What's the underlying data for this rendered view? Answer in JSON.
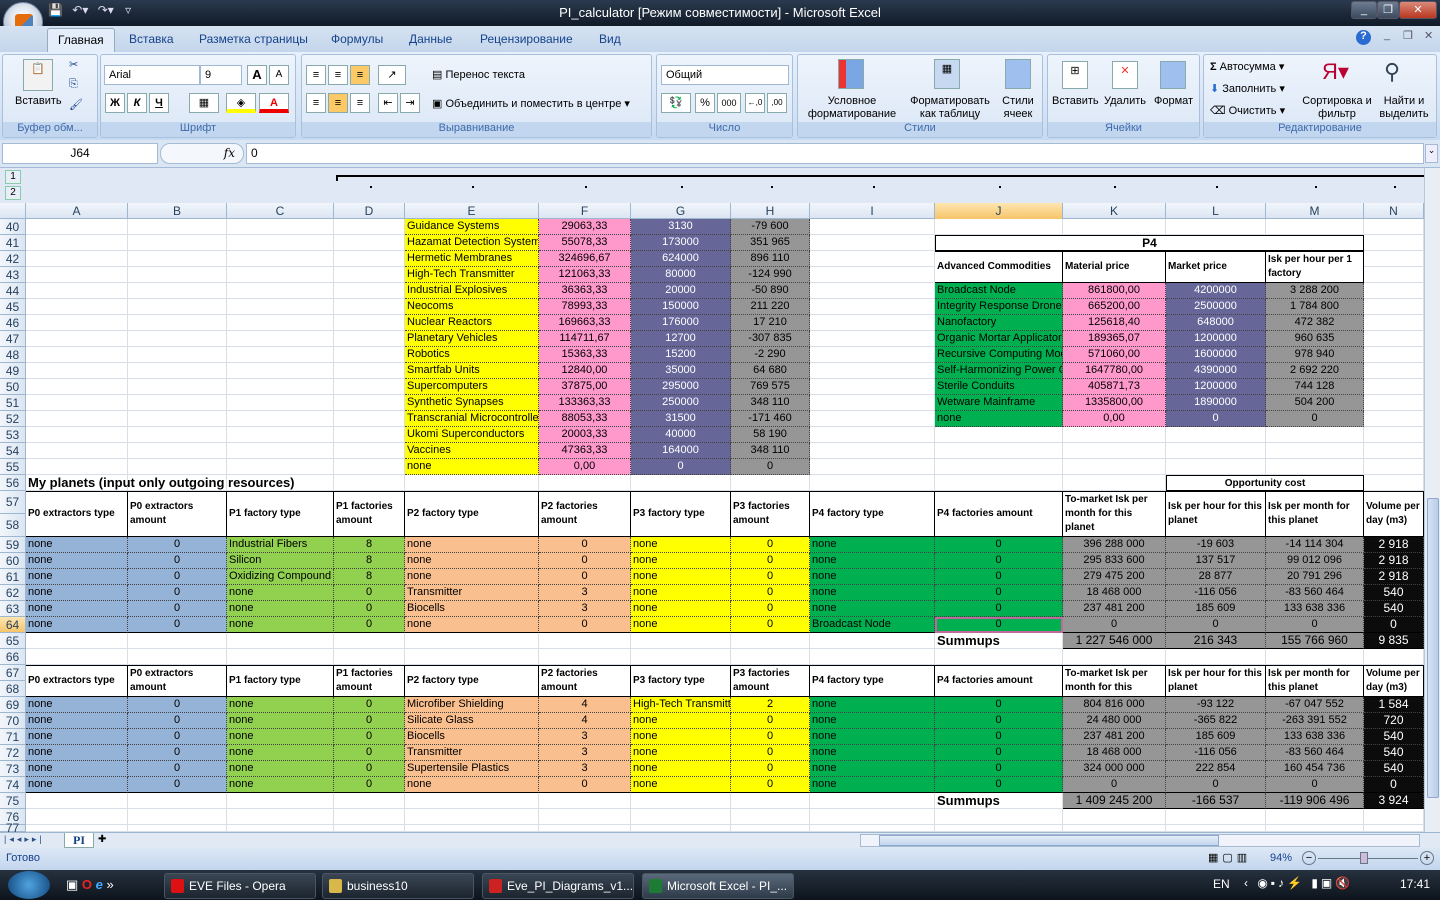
{
  "window": {
    "title": "PI_calculator  [Режим совместимости] - Microsoft Excel"
  },
  "ribbon": {
    "tabs": [
      "Главная",
      "Вставка",
      "Разметка страницы",
      "Формулы",
      "Данные",
      "Рецензирование",
      "Вид"
    ],
    "clipboard": {
      "paste": "Вставить",
      "label": "Буфер обм..."
    },
    "font": {
      "name": "Arial",
      "size": "9",
      "bold": "Ж",
      "italic": "К",
      "underline": "Ч",
      "grow": "A",
      "shrink": "A",
      "label": "Шрифт"
    },
    "alignment": {
      "wrap": "Перенос текста",
      "merge": "Объединить и поместить в центре",
      "label": "Выравнивание"
    },
    "number": {
      "format": "Общий",
      "percent": "%",
      "thousands": "000",
      "label": "Число"
    },
    "styles": {
      "conditional": "Условное форматирование",
      "as_table": "Форматировать как таблицу",
      "cell_styles": "Стили ячеек",
      "label": "Стили"
    },
    "cells": {
      "insert": "Вставить",
      "delete": "Удалить",
      "format": "Формат",
      "label": "Ячейки"
    },
    "editing": {
      "autosum": "Автосумма",
      "fill": "Заполнить",
      "clear": "Очистить",
      "sort": "Сортировка и фильтр",
      "find": "Найти и выделить",
      "label": "Редактирование"
    }
  },
  "formula_bar": {
    "name_box": "J64",
    "fx": "fx",
    "value": "0"
  },
  "outline_levels": [
    "1",
    "2"
  ],
  "columns": [
    "A",
    "B",
    "C",
    "D",
    "E",
    "F",
    "G",
    "H",
    "I",
    "J",
    "K",
    "L",
    "M",
    "N"
  ],
  "row_numbers": [
    "40",
    "41",
    "42",
    "43",
    "44",
    "45",
    "46",
    "47",
    "48",
    "49",
    "50",
    "51",
    "52",
    "53",
    "54",
    "55",
    "56",
    "57",
    "58",
    "59",
    "60",
    "61",
    "62",
    "63",
    "64",
    "65",
    "66",
    "67",
    "68",
    "69",
    "70",
    "71",
    "72",
    "73",
    "74",
    "75",
    "76",
    "77"
  ],
  "selected": {
    "column": "J",
    "row": "64"
  },
  "top_table": {
    "rows": [
      [
        "Guidance Systems",
        "29063,33",
        "3130",
        "-79 600"
      ],
      [
        "Hazamat Detection Systems",
        "55078,33",
        "173000",
        "351 965"
      ],
      [
        "Hermetic Membranes",
        "324696,67",
        "624000",
        "896 110"
      ],
      [
        "High-Tech Transmitter",
        "121063,33",
        "80000",
        "-124 990"
      ],
      [
        "Industrial Explosives",
        "36363,33",
        "20000",
        "-50 890"
      ],
      [
        "Neocoms",
        "78993,33",
        "150000",
        "211 220"
      ],
      [
        "Nuclear Reactors",
        "169663,33",
        "176000",
        "17 210"
      ],
      [
        "Planetary Vehicles",
        "114711,67",
        "12700",
        "-307 835"
      ],
      [
        "Robotics",
        "15363,33",
        "15200",
        "-2 290"
      ],
      [
        "Smartfab Units",
        "12840,00",
        "35000",
        "64 680"
      ],
      [
        "Supercomputers",
        "37875,00",
        "295000",
        "769 575"
      ],
      [
        "Synthetic Synapses",
        "133363,33",
        "250000",
        "348 110"
      ],
      [
        "Transcranial Microcontrollers",
        "88053,33",
        "31500",
        "-171 460"
      ],
      [
        "Ukomi Superconductors",
        "20003,33",
        "40000",
        "58 190"
      ],
      [
        "Vaccines",
        "47363,33",
        "164000",
        "348 110"
      ],
      [
        "none",
        "0,00",
        "0",
        "0"
      ]
    ]
  },
  "p4_table": {
    "title": "P4",
    "headers": [
      "Advanced Commodities",
      "Material price",
      "Market price",
      "Isk per hour per 1 factory"
    ],
    "rows": [
      [
        "Broadcast Node",
        "861800,00",
        "4200000",
        "3 288 200"
      ],
      [
        "Integrity Response Drones",
        "665200,00",
        "2500000",
        "1 784 800"
      ],
      [
        "Nanofactory",
        "125618,40",
        "648000",
        "472 382"
      ],
      [
        "Organic Mortar Applicators",
        "189365,07",
        "1200000",
        "960 635"
      ],
      [
        "Recursive Computing Module",
        "571060,00",
        "1600000",
        "978 940"
      ],
      [
        "Self-Harmonizing Power Core",
        "1647780,00",
        "4390000",
        "2 692 220"
      ],
      [
        "Sterile Conduits",
        "405871,73",
        "1200000",
        "744 128"
      ],
      [
        "Wetware Mainframe",
        "1335800,00",
        "1890000",
        "504 200"
      ],
      [
        "none",
        "0,00",
        "0",
        "0"
      ]
    ]
  },
  "planets": {
    "title": "My planets (input only outgoing resources)",
    "opportunity_cost": "Opportunity cost",
    "headers": [
      "P0 extractors type",
      "P0 extractors amount",
      "P1 factory type",
      "P1 factories amount",
      "P2 factory type",
      "P2 factories amount",
      "P3 factory type",
      "P3 factories amount",
      "P4 factory type",
      "P4 factories amount",
      "To-market Isk per month for this planet",
      "Isk per hour for this planet",
      "Isk per month for this planet",
      "Volume per day (m3)"
    ],
    "headers2": [
      "P0 extractors type",
      "P0 extractors amount",
      "P1 factory type",
      "P1 factories amount",
      "P2 factory type",
      "P2 factories amount",
      "P3 factory type",
      "P3 factories amount",
      "P4 factory type",
      "P4 factories amount",
      "To-market Isk per month for this",
      "Isk per hour for this planet",
      "Isk per month for this planet",
      "Volume per day (m3)"
    ],
    "summups_label": "Summups",
    "planet1": {
      "rows": [
        [
          "none",
          "0",
          "Industrial Fibers",
          "8",
          "none",
          "0",
          "none",
          "0",
          "none",
          "0",
          "396 288 000",
          "-19 603",
          "-14 114 304",
          "2 918"
        ],
        [
          "none",
          "0",
          "Silicon",
          "8",
          "none",
          "0",
          "none",
          "0",
          "none",
          "0",
          "295 833 600",
          "137 517",
          "99 012 096",
          "2 918"
        ],
        [
          "none",
          "0",
          "Oxidizing Compound",
          "8",
          "none",
          "0",
          "none",
          "0",
          "none",
          "0",
          "279 475 200",
          "28 877",
          "20 791 296",
          "2 918"
        ],
        [
          "none",
          "0",
          "none",
          "0",
          "Transmitter",
          "3",
          "none",
          "0",
          "none",
          "0",
          "18 468 000",
          "-116 056",
          "-83 560 464",
          "540"
        ],
        [
          "none",
          "0",
          "none",
          "0",
          "Biocells",
          "3",
          "none",
          "0",
          "none",
          "0",
          "237 481 200",
          "185 609",
          "133 638 336",
          "540"
        ],
        [
          "none",
          "0",
          "none",
          "0",
          "none",
          "0",
          "none",
          "0",
          "Broadcast Node",
          "0",
          "0",
          "0",
          "0",
          "0"
        ]
      ],
      "summups": [
        "1 227 546 000",
        "216 343",
        "155 766 960",
        "9 835"
      ]
    },
    "planet2": {
      "rows": [
        [
          "none",
          "0",
          "none",
          "0",
          "Microfiber Shielding",
          "4",
          "High-Tech Transmitter",
          "2",
          "none",
          "0",
          "804 816 000",
          "-93 122",
          "-67 047 552",
          "1 584"
        ],
        [
          "none",
          "0",
          "none",
          "0",
          "Silicate Glass",
          "4",
          "none",
          "0",
          "none",
          "0",
          "24 480 000",
          "-365 822",
          "-263 391 552",
          "720"
        ],
        [
          "none",
          "0",
          "none",
          "0",
          "Biocells",
          "3",
          "none",
          "0",
          "none",
          "0",
          "237 481 200",
          "185 609",
          "133 638 336",
          "540"
        ],
        [
          "none",
          "0",
          "none",
          "0",
          "Transmitter",
          "3",
          "none",
          "0",
          "none",
          "0",
          "18 468 000",
          "-116 056",
          "-83 560 464",
          "540"
        ],
        [
          "none",
          "0",
          "none",
          "0",
          "Supertensile Plastics",
          "3",
          "none",
          "0",
          "none",
          "0",
          "324 000 000",
          "222 854",
          "160 454 736",
          "540"
        ],
        [
          "none",
          "0",
          "none",
          "0",
          "none",
          "0",
          "none",
          "0",
          "none",
          "0",
          "0",
          "0",
          "0",
          "0"
        ]
      ],
      "summups": [
        "1 409 245 200",
        "-166 537",
        "-119 906 496",
        "3 924"
      ]
    }
  },
  "sheet_tabs": [
    "PI"
  ],
  "status": {
    "ready": "Готово",
    "zoom": "94%"
  },
  "taskbar": {
    "items": [
      "EVE Files - Opera",
      "business10",
      "Eve_PI_Diagrams_v1...",
      "Microsoft Excel - PI_..."
    ],
    "lang": "EN",
    "time": "17:41"
  },
  "colors": {
    "yellow": "#ffff00",
    "pink": "#ff99cc",
    "purple": "#666699",
    "gray": "#969696",
    "light_green": "#92d050",
    "green": "#00b050",
    "blue": "#95b3d7",
    "orange": "#fabf8f"
  }
}
